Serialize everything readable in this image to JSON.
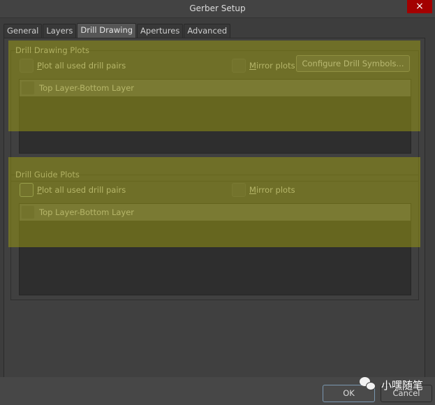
{
  "window": {
    "title": "Gerber Setup",
    "close_icon": "×"
  },
  "tabs": [
    {
      "label": "General",
      "active": false
    },
    {
      "label": "Layers",
      "active": false
    },
    {
      "label": "Drill Drawing",
      "active": true
    },
    {
      "label": "Apertures",
      "active": false
    },
    {
      "label": "Advanced",
      "active": false
    }
  ],
  "drill_drawing": {
    "group_label": "Drill Drawing Plots",
    "plot_all_mnemonic": "P",
    "plot_all_rest": "lot all used drill pairs",
    "plot_all_checked": false,
    "mirror_mnemonic": "M",
    "mirror_rest": "irror plots",
    "mirror_checked": false,
    "configure_button": "Configure Drill Symbols...",
    "layer_pairs": [
      {
        "label": "Top Layer-Bottom Layer",
        "checked": false
      }
    ]
  },
  "drill_guide": {
    "group_label": "Drill Guide Plots",
    "plot_all_mnemonic": "P",
    "plot_all_rest": "lot all used drill pairs",
    "plot_all_checked": false,
    "mirror_mnemonic": "M",
    "mirror_rest": "irror plots",
    "mirror_checked": false,
    "layer_pairs": [
      {
        "label": "Top Layer-Bottom Layer",
        "checked": false
      }
    ]
  },
  "footer": {
    "ok_label": "OK",
    "cancel_label": "Cancel"
  },
  "watermark": {
    "icon": "wechat-icon",
    "text": "小嘿随笔"
  },
  "highlight_color": "#96961a"
}
